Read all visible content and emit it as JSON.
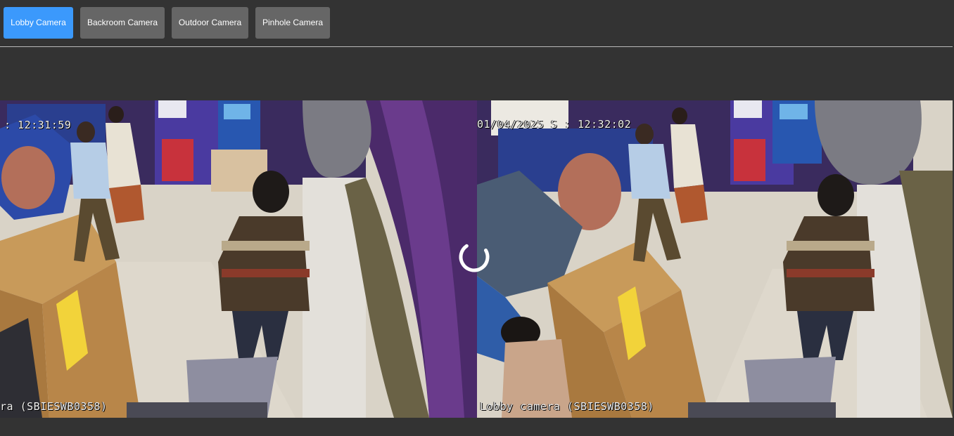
{
  "tabs": [
    {
      "label": "Lobby Camera",
      "active": true
    },
    {
      "label": "Backroom Camera",
      "active": false
    },
    {
      "label": "Outdoor Camera",
      "active": false
    },
    {
      "label": "Pinhole Camera",
      "active": false
    }
  ],
  "feeds": {
    "left": {
      "timestamp": ": 12:31:59",
      "caption": "ra (SBIESWB0358)"
    },
    "right": {
      "timestamp": "01/04/2025 S : 12:32:02",
      "caption": "Lobby camera (SBIESWB0358)"
    }
  },
  "colors": {
    "background": "#333333",
    "active_tab": "#3b99fc",
    "inactive_tab": "#666666",
    "divider": "#b9b9b9"
  },
  "icons": {
    "loading": "spinner-icon"
  }
}
